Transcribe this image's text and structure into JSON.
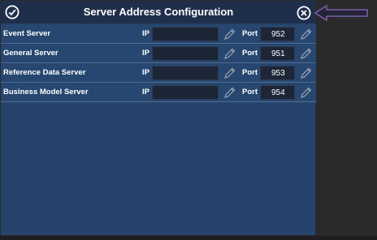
{
  "dialog": {
    "title": "Server Address Configuration",
    "icons": {
      "confirm": "check-circle-icon",
      "close": "close-circle-icon",
      "edit": "pencil-icon"
    }
  },
  "labels": {
    "ip": "IP",
    "port": "Port"
  },
  "servers": [
    {
      "name": "Event Server",
      "ip": "",
      "port": "952"
    },
    {
      "name": "General Server",
      "ip": "",
      "port": "951"
    },
    {
      "name": "Reference Data Server",
      "ip": "",
      "port": "953"
    },
    {
      "name": "Business Model Server",
      "ip": "",
      "port": "954"
    }
  ],
  "colors": {
    "dialog_bg": "#26446b",
    "titlebar_bg": "#1f2f4b",
    "input_bg": "#1c2637",
    "annotation_arrow": "#7b5fa6"
  }
}
